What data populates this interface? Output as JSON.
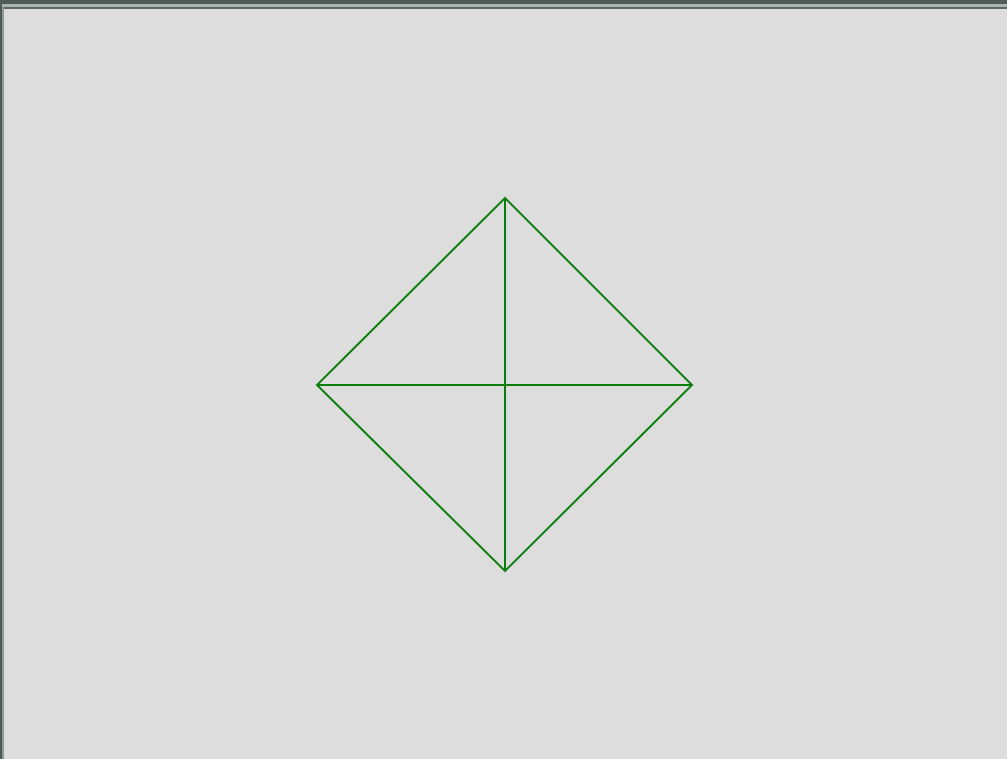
{
  "window": {
    "background_color": "#dddddd",
    "frame_color": "#4f5b56",
    "frame_highlight_color": "#a9b3af"
  },
  "drawing": {
    "line_color": "#0a7d0a",
    "shape": "diamond",
    "includes_diagonals": true
  }
}
